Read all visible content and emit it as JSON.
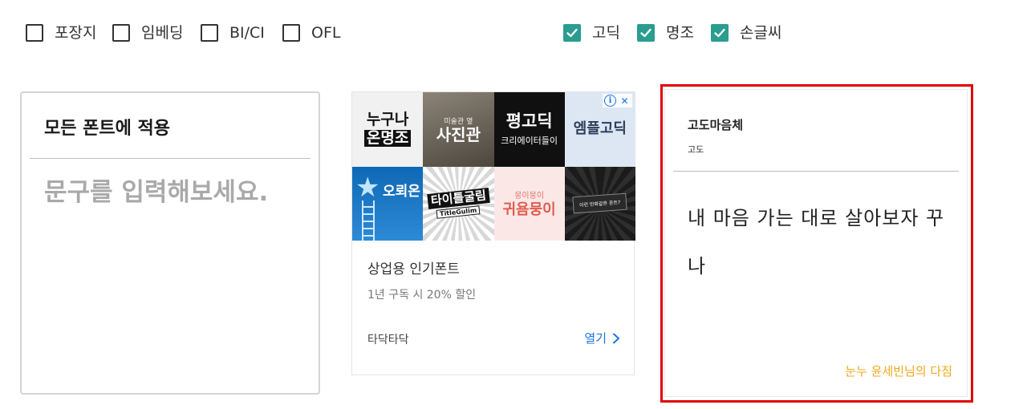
{
  "filters": [
    {
      "label": "포장지",
      "checked": false
    },
    {
      "label": "임베딩",
      "checked": false
    },
    {
      "label": "BI/CI",
      "checked": false
    },
    {
      "label": "OFL",
      "checked": false
    },
    {
      "label": "고딕",
      "checked": true
    },
    {
      "label": "명조",
      "checked": true
    },
    {
      "label": "손글씨",
      "checked": true
    }
  ],
  "apply_card": {
    "title": "모든 폰트에 적용",
    "placeholder": "문구를 입력해보세요."
  },
  "ad": {
    "tiles": [
      {
        "line1": "누구나",
        "line2": "온명조"
      },
      {
        "line1": "미술관 옆",
        "line2": "사진관"
      },
      {
        "line1": "평고딕",
        "line2": "크리에이터들이"
      },
      {
        "line1": "엠플고딕"
      },
      {
        "line1": "오뢰온"
      },
      {
        "line1": "타이틀굴림",
        "line2": "TitleGulim"
      },
      {
        "line1": "뭉이뭉이",
        "line2": "귀욤뭉이"
      },
      {
        "line1": "이런 만화같은 폰트?"
      }
    ],
    "title": "상업용 인기폰트",
    "description": "1년 구독 시 20% 할인",
    "source": "타닥타닥",
    "open_label": "열기"
  },
  "font_card": {
    "font_name": "고도마음체",
    "maker": "고도",
    "sample_text": "내 마음 가는 대로 살아보자 꾸나",
    "caption": "눈누 윤세빈님의 다짐"
  },
  "colors": {
    "checkbox_checked": "#2a9d8f",
    "highlight_border": "#e10000",
    "caption": "#f0a81c",
    "link": "#1a73e8"
  }
}
